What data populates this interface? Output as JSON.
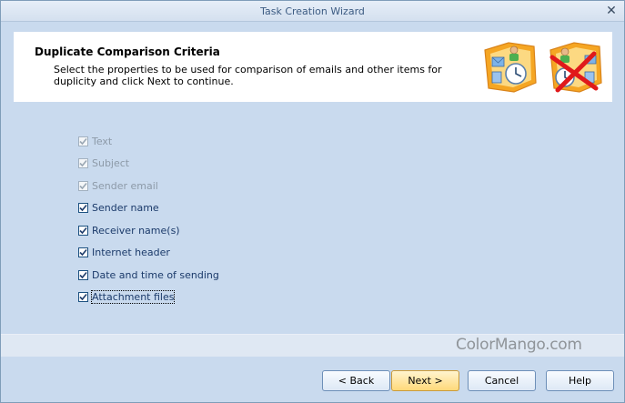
{
  "window": {
    "title": "Task Creation Wizard",
    "close_glyph": "✕"
  },
  "header": {
    "title": "Duplicate Comparison Criteria",
    "description": "Select the properties to be used for comparison of emails and other items for duplicity and click Next to continue."
  },
  "options": [
    {
      "label": "Text",
      "checked": true,
      "enabled": false
    },
    {
      "label": "Subject",
      "checked": true,
      "enabled": false
    },
    {
      "label": "Sender email",
      "checked": true,
      "enabled": false
    },
    {
      "label": "Sender name",
      "checked": true,
      "enabled": true
    },
    {
      "label": "Receiver name(s)",
      "checked": true,
      "enabled": true
    },
    {
      "label": "Internet header",
      "checked": true,
      "enabled": true
    },
    {
      "label": "Date and time of sending",
      "checked": true,
      "enabled": true
    },
    {
      "label": "Attachment files",
      "checked": true,
      "enabled": true,
      "focused": true
    }
  ],
  "watermark": "ColorMango.com",
  "buttons": {
    "back": "< Back",
    "next": "Next >",
    "cancel": "Cancel",
    "help": "Help"
  },
  "colors": {
    "accent": "#3c5b82",
    "background": "#c9daee",
    "button_primary": "#ffd97a"
  },
  "icons": {
    "header_left": "email-contact-clock-icon",
    "header_right": "email-delete-clock-icon"
  }
}
